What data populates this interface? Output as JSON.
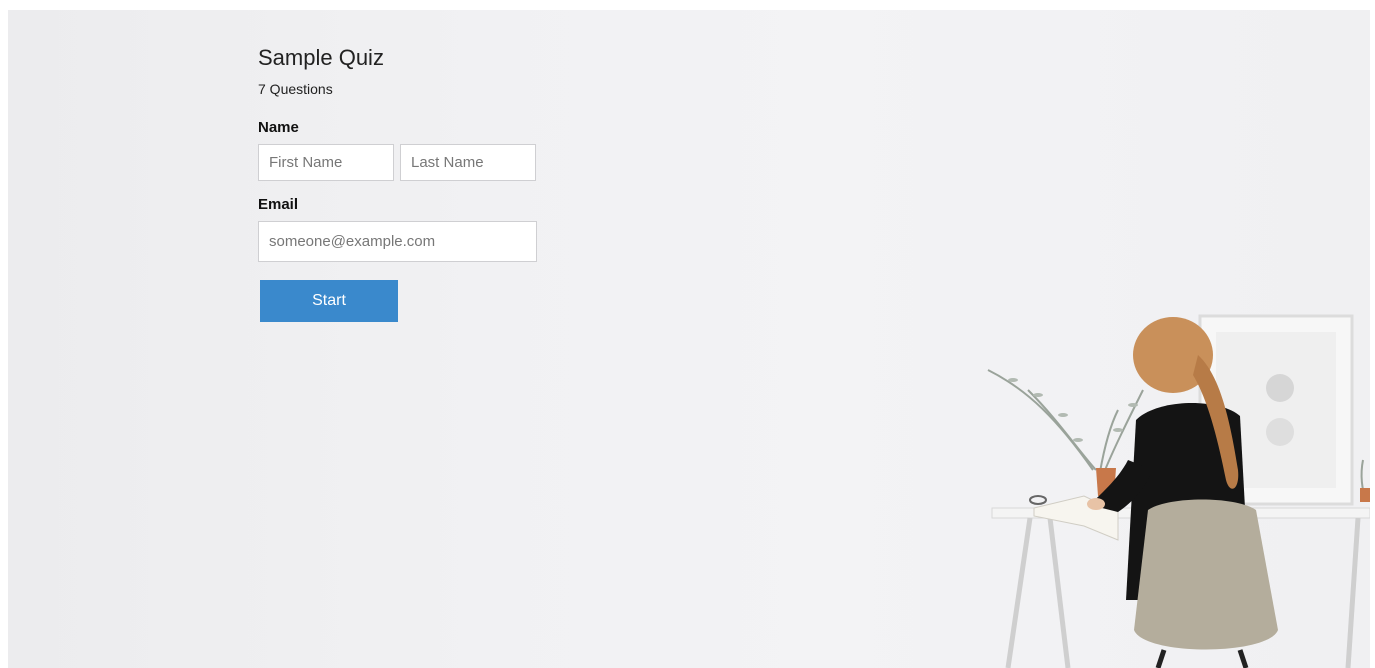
{
  "quiz": {
    "title": "Sample Quiz",
    "subtitle": "7 Questions"
  },
  "form": {
    "name_label": "Name",
    "first_name_placeholder": "First Name",
    "last_name_placeholder": "Last Name",
    "email_label": "Email",
    "email_placeholder": "someone@example.com",
    "start_label": "Start"
  },
  "colors": {
    "accent": "#3a89cc",
    "background": "#f1f1f3"
  },
  "illustration": {
    "icon": "woman-at-desk-photo"
  }
}
